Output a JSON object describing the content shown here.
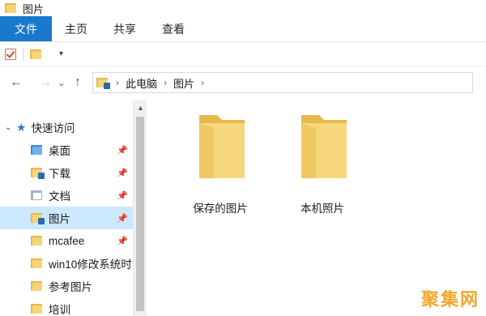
{
  "window": {
    "title": "图片"
  },
  "ribbon": {
    "tabs": [
      "文件",
      "主页",
      "共享",
      "查看"
    ]
  },
  "address": {
    "crumbs": [
      "此电脑",
      "图片"
    ]
  },
  "nav_pane": {
    "quick_access": "快速访问",
    "items": [
      {
        "label": "桌面",
        "pinned": true
      },
      {
        "label": "下载",
        "pinned": true
      },
      {
        "label": "文档",
        "pinned": true
      },
      {
        "label": "图片",
        "pinned": true,
        "selected": true
      },
      {
        "label": "mcafee",
        "pinned": true
      },
      {
        "label": "win10修改系统时",
        "pinned": false
      },
      {
        "label": "参考图片",
        "pinned": false
      },
      {
        "label": "培训",
        "pinned": false
      }
    ]
  },
  "content": {
    "folders": [
      "保存的图片",
      "本机照片"
    ]
  },
  "watermark": "聚集网",
  "colors": {
    "accent": "#1979ca",
    "selection": "#cce8ff",
    "folder": "#f6d47a"
  }
}
